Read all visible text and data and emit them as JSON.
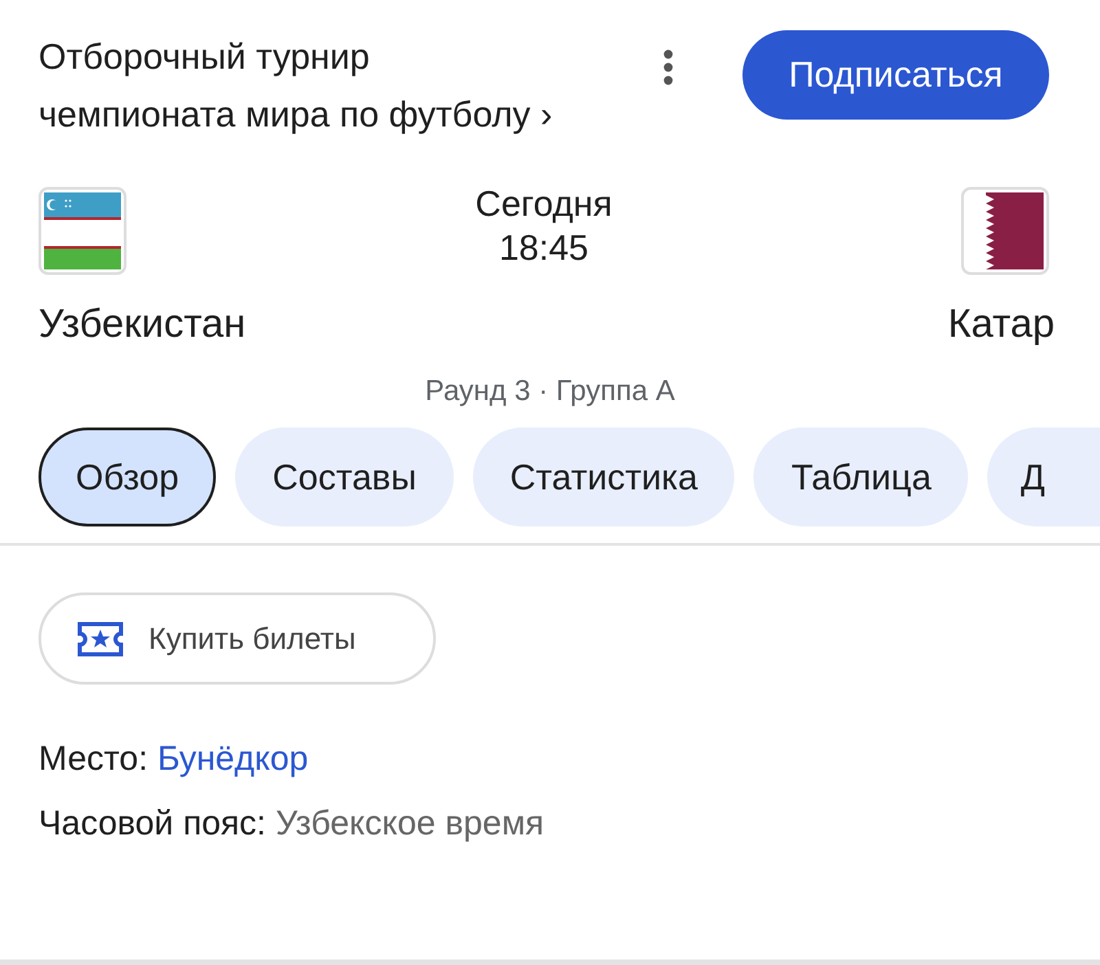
{
  "header": {
    "title_lines": [
      "Отборочный турнир",
      "чемпионата мира по футболу"
    ],
    "chevron": "›",
    "subscribe": "Подписаться"
  },
  "match": {
    "home": {
      "name": "Узбекистан",
      "kind": "uzbekistan"
    },
    "away": {
      "name": "Катар",
      "kind": "qatar"
    },
    "day": "Сегодня",
    "time": "18:45",
    "round": "Раунд 3 · Группа A"
  },
  "tabs": [
    {
      "label": "Обзор",
      "selected": true
    },
    {
      "label": "Составы",
      "selected": false
    },
    {
      "label": "Статистика",
      "selected": false
    },
    {
      "label": "Таблица",
      "selected": false
    },
    {
      "label": "Д",
      "selected": false
    }
  ],
  "tickets": {
    "label": "Купить билеты"
  },
  "info": [
    {
      "label": "Место:",
      "value": "Бунёдкор",
      "kind": "link"
    },
    {
      "label": "Часовой пояс:",
      "value": "Узбекское время",
      "kind": "plain"
    }
  ]
}
